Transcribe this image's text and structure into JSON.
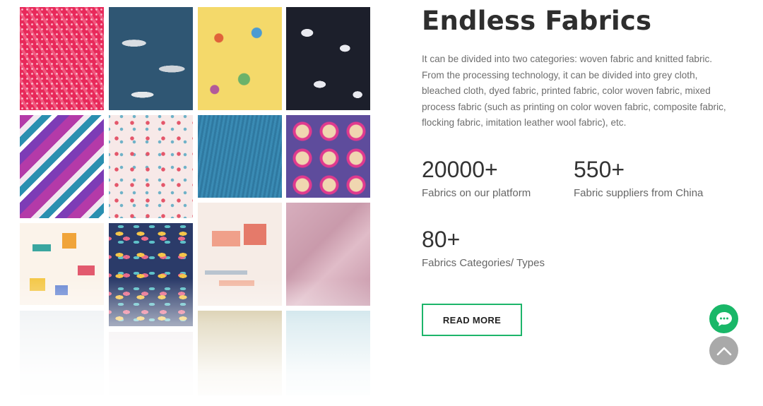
{
  "heading": "Endless Fabrics",
  "description": "It can be divided into two categories: woven fabric and knitted fabric. From the processing technology, it can be divided into grey cloth, bleached cloth, dyed fabric, printed fabric, color woven fabric, mixed process fabric (such as printing on color woven fabric, composite fabric, flocking fabric, imitation leather wool fabric), etc.",
  "stats": [
    {
      "value": "20000+",
      "label": "Fabrics on our platform"
    },
    {
      "value": "550+",
      "label": "Fabric suppliers from China"
    },
    {
      "value": "80+",
      "label": "Fabrics Categories/ Types"
    }
  ],
  "cta": {
    "label": "READ MORE",
    "border_color": "#1db56a"
  },
  "floating": {
    "chat_icon": "chat-bubble-icon",
    "chat_color": "#19b768",
    "top_icon": "chevron-up-icon",
    "top_color": "#a9a9a9"
  },
  "gallery": {
    "tiles": [
      "pink dotted fabric",
      "blue shark print",
      "yellow cartoon print",
      "black leaf print",
      "purple swirl print",
      "white floral print",
      "blue denim",
      "purple badge print",
      "geometric shapes print",
      "navy floral print",
      "pink village print",
      "mauve plain fabric"
    ]
  }
}
